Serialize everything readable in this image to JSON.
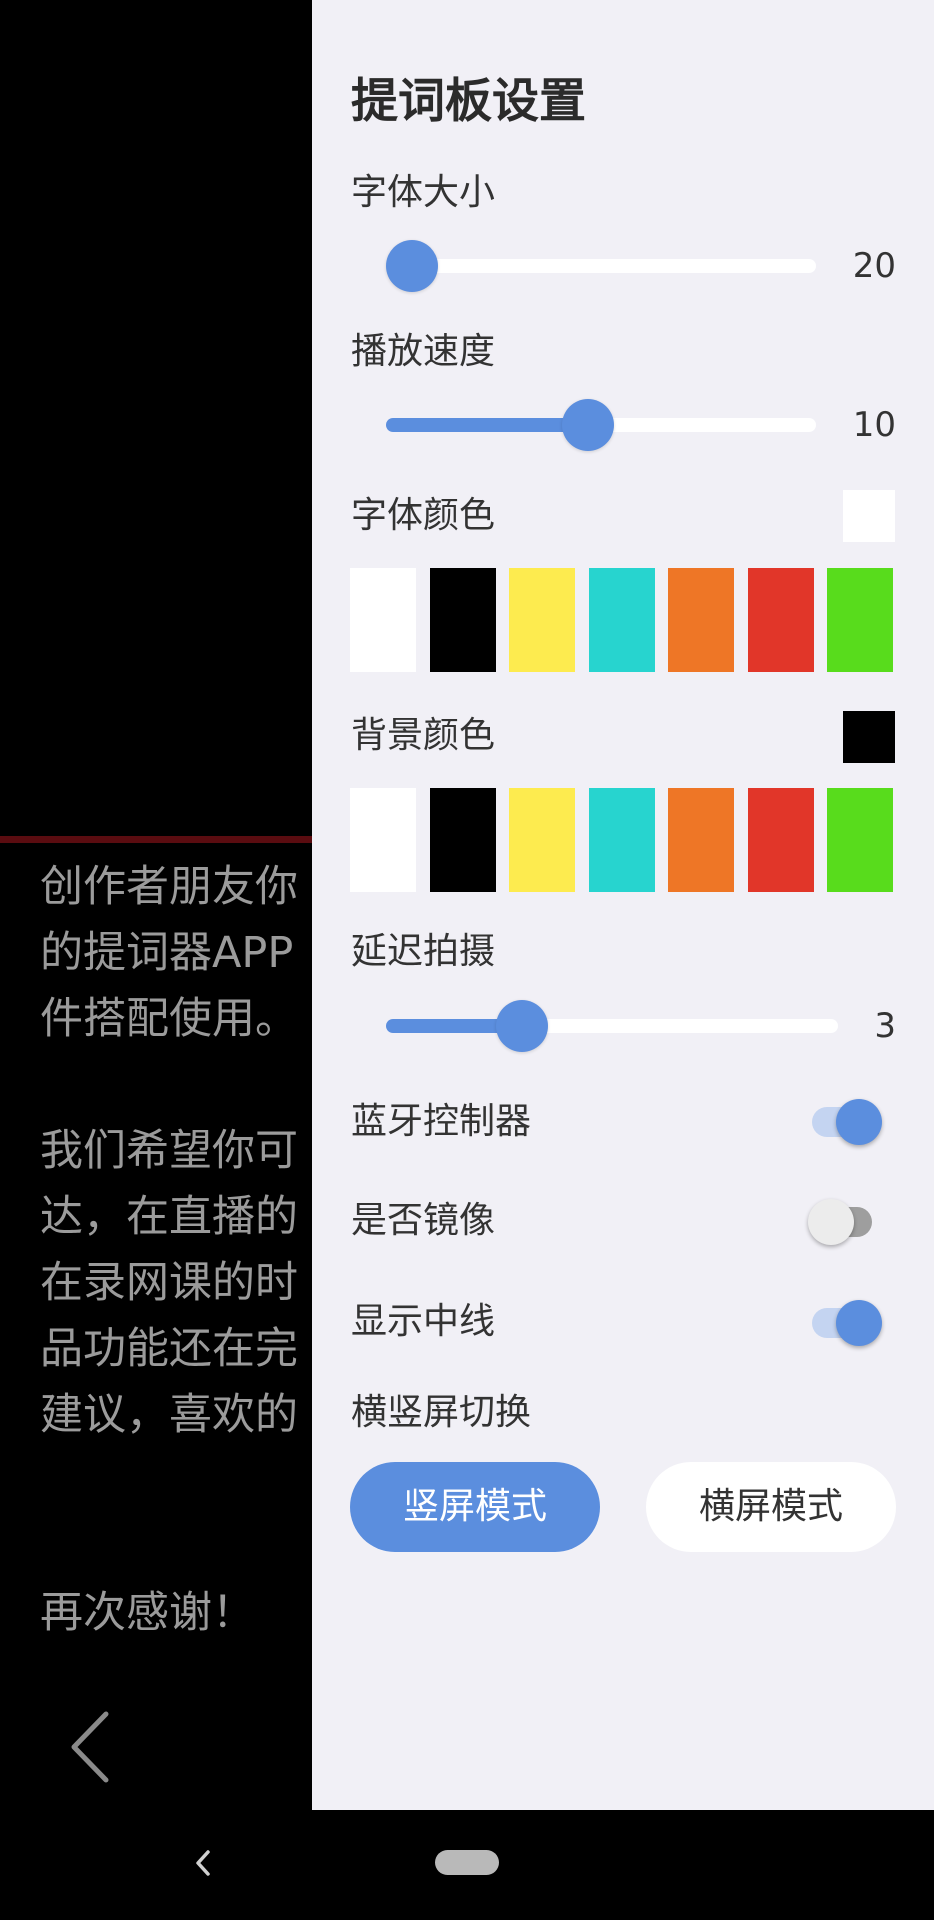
{
  "prompter": {
    "script_text": "创作者朋友你\n的提词器APP\n件搭配使用。\n\n我们希望你可\n达，在直播的\n在录网课的时\n品功能还在完\n建议，喜欢的\n\n\n再次感谢！",
    "back_icon": "chevron-left-icon",
    "center_line_color": "#5a0c10"
  },
  "settings": {
    "title": "提词板设置",
    "font_size": {
      "label": "字体大小",
      "value": "20",
      "level": 0.0
    },
    "play_speed": {
      "label": "播放速度",
      "value": "10",
      "level": 0.47
    },
    "font_color": {
      "label": "字体颜色",
      "selected": "#ffffff",
      "palette": [
        "#ffffff",
        "#000000",
        "#fdeb4f",
        "#27d4cf",
        "#ee7626",
        "#e13629",
        "#58dc1c"
      ]
    },
    "bg_color": {
      "label": "背景颜色",
      "selected": "#000000",
      "palette": [
        "#ffffff",
        "#000000",
        "#fdeb4f",
        "#27d4cf",
        "#ee7626",
        "#e13629",
        "#58dc1c"
      ]
    },
    "delay_shot": {
      "label": "延迟拍摄",
      "value": "3",
      "level": 0.3
    },
    "bluetooth": {
      "label": "蓝牙控制器",
      "on": true
    },
    "mirror": {
      "label": "是否镜像",
      "on": false
    },
    "center_line": {
      "label": "显示中线",
      "on": true
    },
    "orientation": {
      "label": "横竖屏切换",
      "portrait_label": "竖屏模式",
      "landscape_label": "横屏模式",
      "selected": "portrait"
    },
    "accent_color": "#5b8ede"
  },
  "system_nav": {
    "back_icon": "back-triangle-icon",
    "home_icon": "home-pill-icon"
  }
}
